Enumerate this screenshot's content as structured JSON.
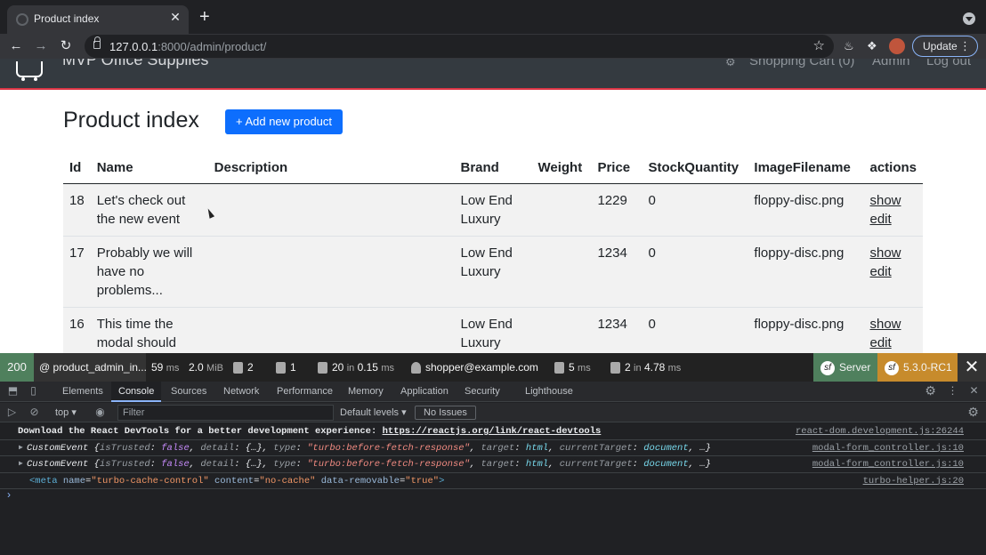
{
  "browser": {
    "tab_title": "Product index",
    "tab_close": "✕",
    "new_tab": "+",
    "url_host": "127.0.0.1",
    "url_rest": ":8000/admin/product/",
    "update_label": "Update"
  },
  "site": {
    "brand": "MVP Office Supplies",
    "nav_cart": "Shopping Cart (0)",
    "nav_admin": "Admin",
    "nav_logout": "Log out"
  },
  "page": {
    "title": "Product index",
    "add_button": "+ Add new product",
    "columns": [
      "Id",
      "Name",
      "Description",
      "Brand",
      "Weight",
      "Price",
      "StockQuantity",
      "ImageFilename",
      "actions"
    ],
    "rows": [
      {
        "id": "18",
        "name": "Let's check out the new event",
        "description": "",
        "brand": "Low End Luxury",
        "weight": "",
        "price": "1229",
        "stock": "0",
        "image": "floppy-disc.png",
        "show": "show",
        "edit": "edit"
      },
      {
        "id": "17",
        "name": "Probably we will have no problems...",
        "description": "",
        "brand": "Low End Luxury",
        "weight": "",
        "price": "1234",
        "stock": "0",
        "image": "floppy-disc.png",
        "show": "show",
        "edit": "edit"
      },
      {
        "id": "16",
        "name": "This time the modal should close",
        "description": "",
        "brand": "Low End Luxury",
        "weight": "",
        "price": "1234",
        "stock": "0",
        "image": "floppy-disc.png",
        "show": "show",
        "edit": "edit"
      }
    ]
  },
  "sf_toolbar": {
    "status": "200",
    "route": "@ product_admin_in...",
    "time_value": "59",
    "time_unit": "ms",
    "memory_value": "2.0",
    "memory_unit": "MiB",
    "forms": "2",
    "logs": "1",
    "cache_value": "20",
    "cache_in": "in",
    "cache_time": "0.15",
    "cache_unit": "ms",
    "user": "shopper@example.com",
    "twig_value": "5",
    "twig_unit": "ms",
    "db_value": "2",
    "db_in": "in",
    "db_time": "4.78",
    "db_unit": "ms",
    "server": "Server",
    "version": "5.3.0-RC1",
    "close": "✕"
  },
  "devtools": {
    "tabs": [
      "Elements",
      "Console",
      "Sources",
      "Network",
      "Performance",
      "Memory",
      "Application",
      "Security",
      "Lighthouse"
    ],
    "active_tab": "Console",
    "context": "top",
    "filter_placeholder": "Filter",
    "levels": "Default levels",
    "issues": "No Issues",
    "messages": [
      {
        "text": "Download the React DevTools for a better development experience: ",
        "link": "https://reactjs.org/link/react-devtools",
        "source": "react-dom.development.js:26244"
      },
      {
        "source": "modal-form_controller.js:10"
      },
      {
        "source": "modal-form_controller.js:10"
      },
      {
        "source": "turbo-helper.js:20"
      }
    ],
    "event_label": "CustomEvent",
    "event_type": "\"turbo:before-fetch-response\""
  },
  "colors": {
    "accent": "#0d6efd",
    "navbar": "#343a40",
    "navbar_border": "#dc3545",
    "sf_status_ok": "#4f805d",
    "sf_version": "#c78b2c"
  }
}
